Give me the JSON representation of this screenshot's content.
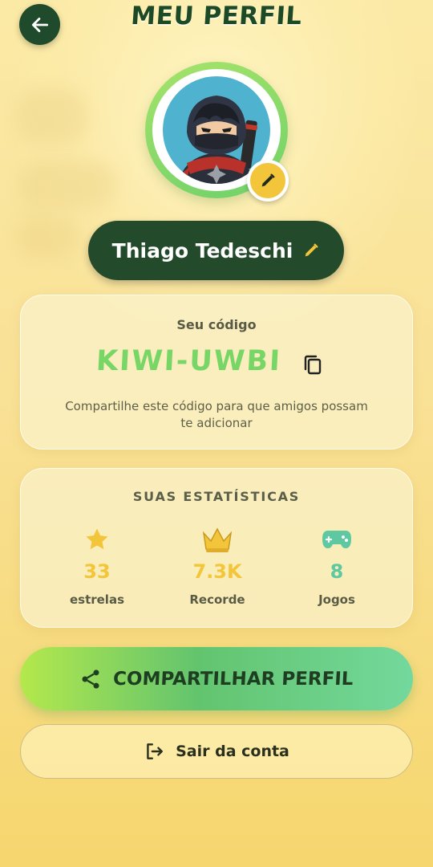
{
  "header": {
    "title": "MEU PERFIL",
    "back_icon": "arrow-left-icon"
  },
  "profile": {
    "avatar_icon": "ninja-avatar",
    "edit_avatar_icon": "pencil-icon",
    "name": "Thiago Tedeschi",
    "edit_name_icon": "pencil-icon"
  },
  "code_card": {
    "label": "Seu código",
    "code": "KIWI-UWBI",
    "copy_icon": "copy-icon",
    "help": "Compartilhe este código para que amigos possam te adicionar"
  },
  "stats": {
    "title": "SUAS ESTATÍSTICAS",
    "items": [
      {
        "icon": "star-icon",
        "value": "33",
        "label": "estrelas",
        "color": "#f3c53a"
      },
      {
        "icon": "crown-icon",
        "value": "7.3K",
        "label": "Recorde",
        "color": "#f3c53a"
      },
      {
        "icon": "gamepad-icon",
        "value": "8",
        "label": "Jogos",
        "color": "#5ec9a0"
      }
    ]
  },
  "actions": {
    "share_label": "COMPARTILHAR PERFIL",
    "share_icon": "share-icon",
    "logout_label": "Sair da conta",
    "logout_icon": "logout-icon"
  },
  "colors": {
    "dark_green": "#1f4a2b",
    "accent_yellow": "#f3c53a",
    "code_green": "#78d666",
    "teal": "#5ec9a0"
  }
}
